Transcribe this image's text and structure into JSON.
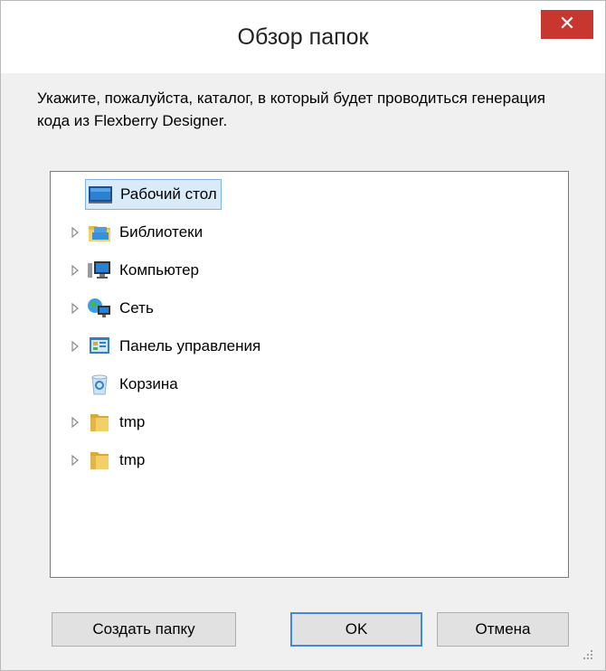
{
  "window": {
    "title": "Обзор папок",
    "close_glyph": "✕"
  },
  "instruction": "Укажите, пожалуйста, каталог, в который будет проводиться генерация кода из Flexberry Designer.",
  "tree": {
    "items": [
      {
        "label": "Рабочий стол",
        "icon": "desktop-icon",
        "expandable": false,
        "selected": true
      },
      {
        "label": "Библиотеки",
        "icon": "libraries-icon",
        "expandable": true,
        "selected": false
      },
      {
        "label": "Компьютер",
        "icon": "computer-icon",
        "expandable": true,
        "selected": false
      },
      {
        "label": "Сеть",
        "icon": "network-icon",
        "expandable": true,
        "selected": false
      },
      {
        "label": "Панель управления",
        "icon": "control-panel-icon",
        "expandable": true,
        "selected": false
      },
      {
        "label": "Корзина",
        "icon": "recycle-bin-icon",
        "expandable": false,
        "selected": false
      },
      {
        "label": "tmp",
        "icon": "folder-icon",
        "expandable": true,
        "selected": false
      },
      {
        "label": "tmp",
        "icon": "folder-icon",
        "expandable": true,
        "selected": false
      }
    ]
  },
  "buttons": {
    "new_folder": "Создать папку",
    "ok": "OK",
    "cancel": "Отмена"
  },
  "colors": {
    "close_button": "#c7372f",
    "selection_fill": "#d9ebf9",
    "selection_border": "#7cb5e6",
    "default_button_border": "#3c8bd6"
  }
}
